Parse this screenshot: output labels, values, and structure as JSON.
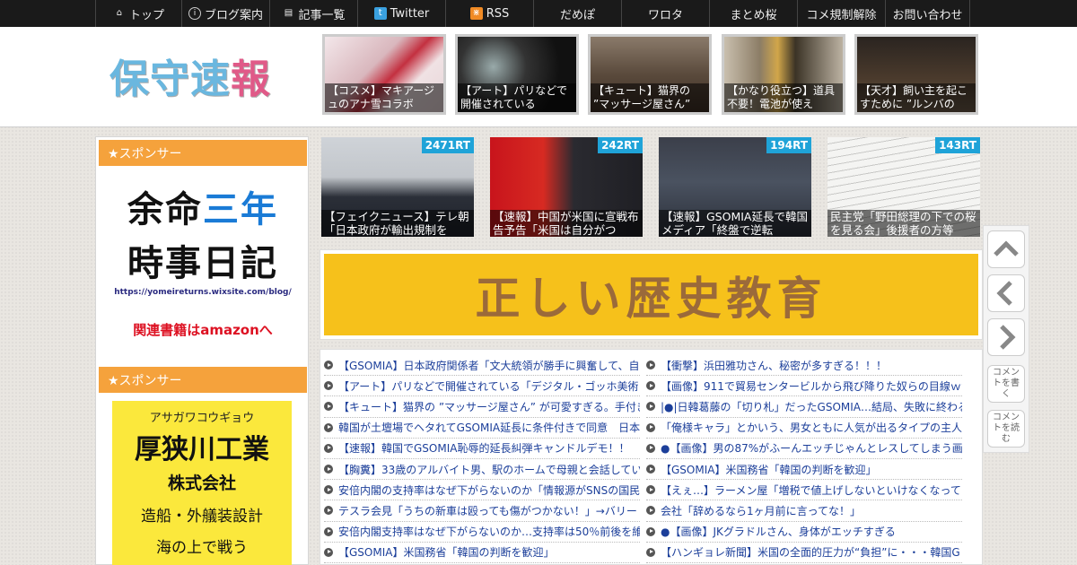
{
  "nav": {
    "items": [
      {
        "label": "トップ",
        "icon": "home-icon"
      },
      {
        "label": "ブログ案内",
        "icon": "info-icon"
      },
      {
        "label": "記事一覧",
        "icon": "list-icon"
      },
      {
        "label": "Twitter",
        "icon": "twitter-icon"
      },
      {
        "label": "RSS",
        "icon": "rss-icon"
      },
      {
        "label": "だめぽ"
      },
      {
        "label": "ワロタ"
      },
      {
        "label": "まとめ桜"
      },
      {
        "label": "コメ規制解除"
      },
      {
        "label": "お問い合わせ"
      }
    ]
  },
  "header": {
    "logo": {
      "part1": "保守速",
      "part2": "報"
    },
    "thumbs": [
      {
        "caption": "【コスメ】マキアージュのアナ雪コラボ"
      },
      {
        "caption": "【アート】パリなどで開催されている"
      },
      {
        "caption": "【キュート】猫界の ”マッサージ屋さん”"
      },
      {
        "caption": "【かなり役立つ】道具不要！電池が使え"
      },
      {
        "caption": "【天才】飼い主を起こすために ”ルンバの"
      }
    ]
  },
  "sidebar": {
    "sponsor_label_1": "★スポンサー",
    "ad1": {
      "line1_a": "余命",
      "line1_b": "三年",
      "line2": "時事日記",
      "url": "https://yomeireturns.wixsite.com/blog/",
      "amazon": "関連書籍はamazonへ"
    },
    "sponsor_label_2": "★スポンサー",
    "ad2": {
      "kana": "アサガワコウギョウ",
      "name": "厚狭川工業",
      "corp": "株式会社",
      "desc": "造船・外艤装設計",
      "extra": "海の上で戦う"
    }
  },
  "featured": [
    {
      "rt": "2471RT",
      "caption": "【フェイクニュース】テレ朝「日本政府が輸出規制を"
    },
    {
      "rt": "242RT",
      "caption": "【速報】中国が米国に宣戦布告予告「米国は自分がつ"
    },
    {
      "rt": "194RT",
      "caption": "【速報】GSOMIA延長で韓国メディア「終盤で逆転"
    },
    {
      "rt": "143RT",
      "caption": "民主党「野田総理の下での桜を見る会」後援者の方等"
    }
  ],
  "banner": {
    "text": "正しい歴史教育"
  },
  "articles": {
    "left": [
      "【GSOMIA】日本政府関係者「文大統領が勝手に興奮して、自",
      "【アート】パリなどで開催されている「デジタル・ゴッホ美術",
      "【キュート】猫界の ”マッサージ屋さん” が可愛すぎる。手付き",
      "韓国が土壇場でヘタれてGSOMIA延長に条件付きで同意　日本",
      "【速報】韓国でGSOMIA恥辱的延長糾弾キャンドルデモ！！",
      "【胸糞】33歳のアルバイト男、駅のホームで母親と会話してい",
      "安倍内閣の支持率はなぜ下がらないのか「情報源がSNSの国民",
      "テスラ会見「うちの新車は殴っても傷がつかない！」→バリー",
      "安倍内閣支持率はなぜ下がらないのか…支持率は50％前後を維",
      "【GSOMIA】米国務省「韓国の判断を歓迎」"
    ],
    "right": [
      "【衝撃】浜田雅功さん、秘密が多すぎる！！！",
      "【画像】911で貿易センタービルから飛び降りた奴らの目線ｗｗ",
      "|●|日韓葛藤の「切り札」だったGSOMIA…結局、失敗に終わる",
      "「俺様キャラ」とかいう、男女ともに人気が出るタイプの主人",
      "●【画像】男の87%がふーんエッチじゃんとレスしてしまう画像",
      "【GSOMIA】米国務省「韓国の判断を歓迎」",
      "【えぇ…】ラーメン屋「増税で値上げしないといけなくなって",
      "会社「辞めるなら1ヶ月前に言ってな！」",
      "●【画像】JKグラドルさん、身体がエッチすぎる",
      "【ハンギョレ新聞】米国の全面的圧力が“負担”に・・・韓国G"
    ]
  },
  "side_buttons": {
    "comment_write": "コメントを書く",
    "comment_read": "コメントを読む"
  }
}
